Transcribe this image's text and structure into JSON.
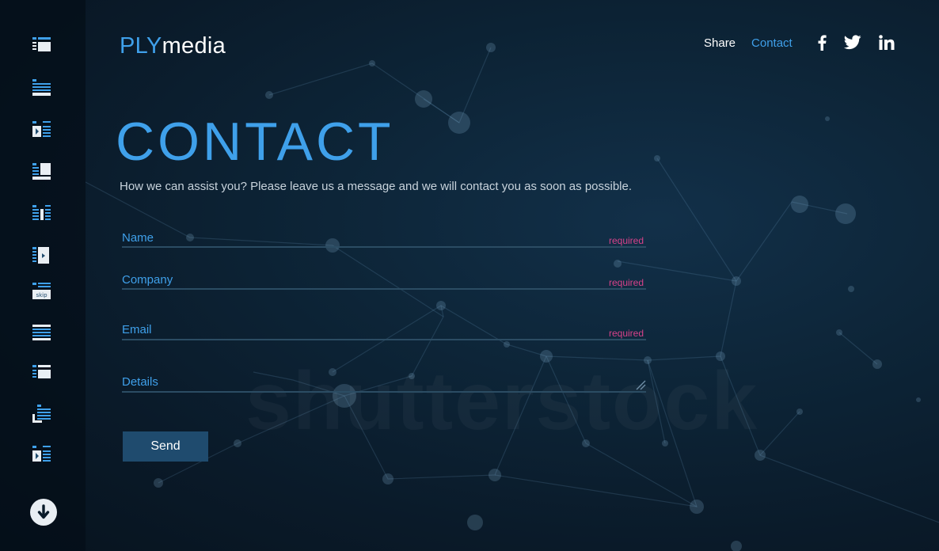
{
  "brand": {
    "part1": "PLY",
    "part2": "media"
  },
  "nav": {
    "share": "Share",
    "contact": "Contact"
  },
  "social": [
    "facebook-icon",
    "twitter-icon",
    "linkedin-icon"
  ],
  "sidebar": {
    "items": [
      "layout-list-image-icon",
      "layout-text-icon",
      "layout-media-text-icon",
      "layout-text-image-icon",
      "layout-columns-icon",
      "layout-video-icon",
      "layout-skip-icon",
      "layout-full-text-icon",
      "layout-list-box-icon",
      "layout-corner-list-icon",
      "layout-media-list-icon"
    ],
    "skip_label": "skip",
    "down_button": "arrow-down-icon"
  },
  "page": {
    "title": "CONTACT",
    "subtitle": "How we can assist you? Please leave us a message and we will contact you as soon as possible."
  },
  "form": {
    "name": {
      "label": "Name",
      "required": "required"
    },
    "company": {
      "label": "Company",
      "required": "required"
    },
    "email": {
      "label": "Email",
      "required": "required"
    },
    "details": {
      "label": "Details"
    },
    "send": "Send"
  },
  "watermark": "shutterstock",
  "colors": {
    "accent": "#3fa0ea",
    "required": "#d7428a",
    "background": "#0a1b2a",
    "button": "#1f4b6e"
  }
}
